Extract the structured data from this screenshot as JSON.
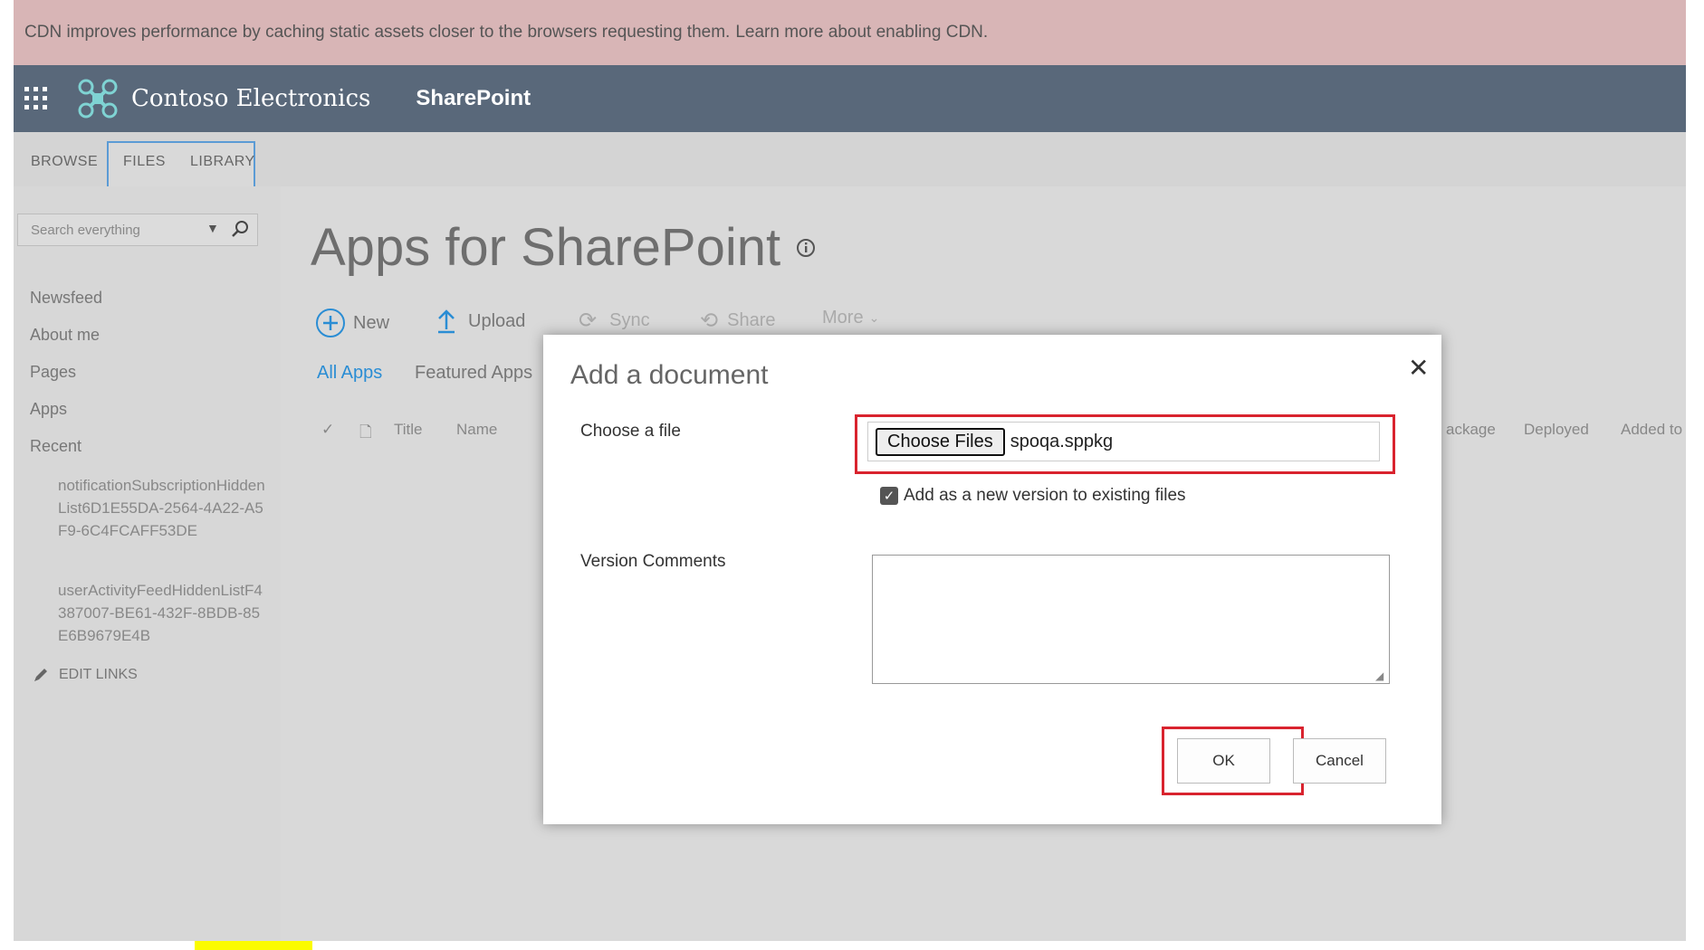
{
  "notice": {
    "text": "CDN improves performance by caching static assets closer to the browsers requesting them.",
    "link": "Learn more about enabling CDN."
  },
  "suitebar": {
    "brand": "Contoso Electronics",
    "app_name": "SharePoint"
  },
  "ribbon": {
    "tabs": [
      "BROWSE",
      "FILES",
      "LIBRARY"
    ]
  },
  "sidebar": {
    "search_placeholder": "Search everything",
    "nav": [
      "Newsfeed",
      "About me",
      "Pages",
      "Apps",
      "Recent"
    ],
    "recent": [
      "notificationSubscriptionHiddenList6D1E55DA-2564-4A22-A5F9-6C4FCAFF53DE",
      "userActivityFeedHiddenListF4387007-BE61-432F-8BDB-85E6B9679E4B"
    ],
    "edit_links": "EDIT LINKS"
  },
  "main": {
    "title": "Apps for SharePoint",
    "commands": {
      "new": "New",
      "upload": "Upload",
      "sync": "Sync",
      "share": "Share",
      "more": "More"
    },
    "views": {
      "all": "All Apps",
      "featured": "Featured Apps"
    },
    "columns": {
      "title": "Title",
      "name": "Name",
      "package": "ackage",
      "deployed": "Deployed",
      "added_to": "Added to"
    }
  },
  "dialog": {
    "title": "Add a document",
    "choose_label": "Choose a file",
    "choose_button": "Choose Files",
    "file_name": "spoqa.sppkg",
    "version_label": "Add as a new version to existing files",
    "version_checked": true,
    "comments_label": "Version Comments",
    "comments_value": "",
    "ok": "OK",
    "cancel": "Cancel"
  },
  "colors": {
    "notice_bg": "#d8b5b6",
    "suitebar_bg": "#59687a",
    "accent": "#2a8dd4",
    "highlight_red": "#d9232e",
    "marker_yellow": "#fbfb00"
  }
}
